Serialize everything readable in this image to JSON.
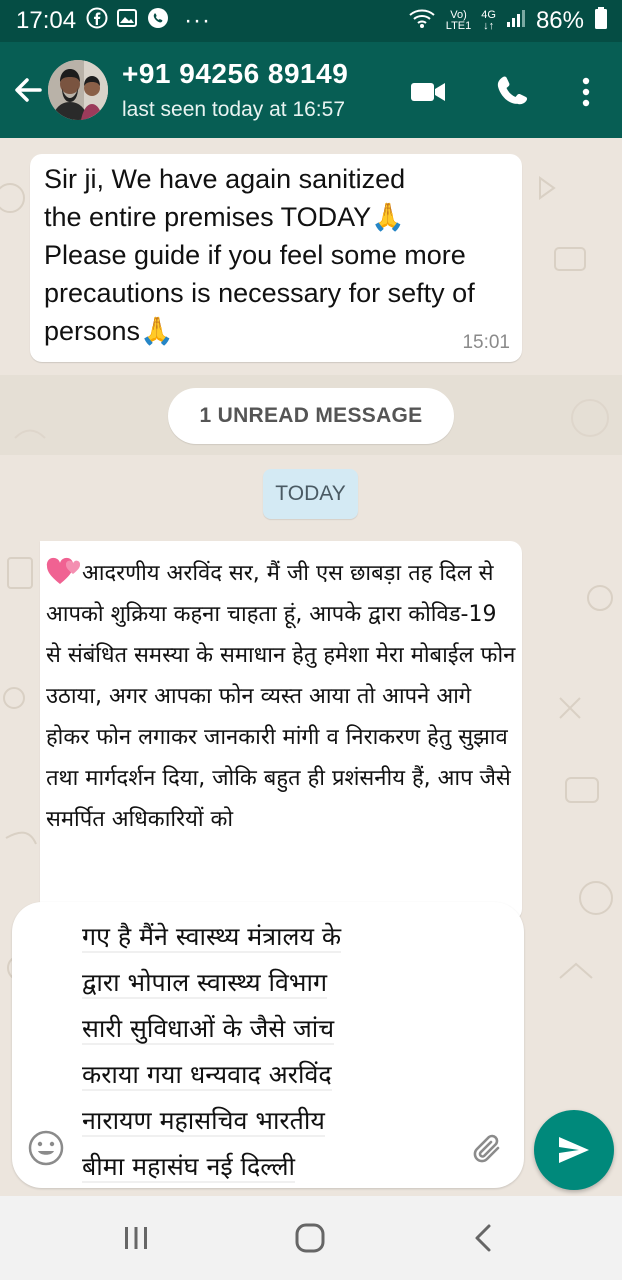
{
  "status_bar": {
    "time": "17:04",
    "network_top": "Vo)",
    "network_bottom": "LTE1",
    "network_type": "4G",
    "battery": "86%",
    "icons": [
      "facebook-icon",
      "gallery-icon",
      "whatsapp-icon",
      "more-dots-icon",
      "wifi-icon",
      "signal-icon",
      "battery-icon"
    ]
  },
  "header": {
    "contact": "+91 94256 89149",
    "last_seen": "last seen today at 16:57",
    "icons": [
      "back-arrow-icon",
      "video-call-icon",
      "voice-call-icon",
      "overflow-menu-icon"
    ]
  },
  "messages": [
    {
      "text": "Sir ji,  We have again sanitized\nthe entire premises TODAY🙏\nPlease guide if you feel some more\nprecautions is necessary for sefty of\npersons🙏",
      "time": "15:01"
    },
    {
      "text": "आदरणीय अरविंद सर, मैं जी एस छाबड़ा तह दिल से आपको शुक्रिया कहना चाहता हूं, आपके द्वारा कोविड-19 से संबंधित समस्या के समाधान हेतु हमेशा मेरा मोबाईल फोन उठाया, अगर आपका फोन व्यस्त आया तो आपने आगे होकर फोन लगाकर जानकारी मांगी व निराकरण हेतु सुझाव तथा मार्गदर्शन दिया, जोकि बहुत ही प्रशंसनीय हैं, आप जैसे समर्पित अधिकारियों को"
    }
  ],
  "unread_label": "1 UNREAD MESSAGE",
  "date_label": "TODAY",
  "composer": {
    "lines": [
      "गए  है मैंने स्वास्थ्य मंत्रालय के",
      "द्वारा भोपाल स्वास्थ्य विभाग",
      "सारी सुविधाओं के जैसे जांच",
      "कराया गया धन्यवाद अरविंद",
      "नारायण महासचिव भारतीय",
      "बीमा महासंघ नई दिल्ली"
    ],
    "icons": [
      "emoji-icon",
      "attachment-icon",
      "send-icon"
    ]
  },
  "navigation": [
    "recent-apps-icon",
    "home-icon",
    "back-icon"
  ],
  "colors": {
    "header": "#075e54",
    "status_bar": "#054d44",
    "wallpaper": "#ece5dd",
    "send": "#00897b",
    "date_pill": "#d4eaf4"
  }
}
